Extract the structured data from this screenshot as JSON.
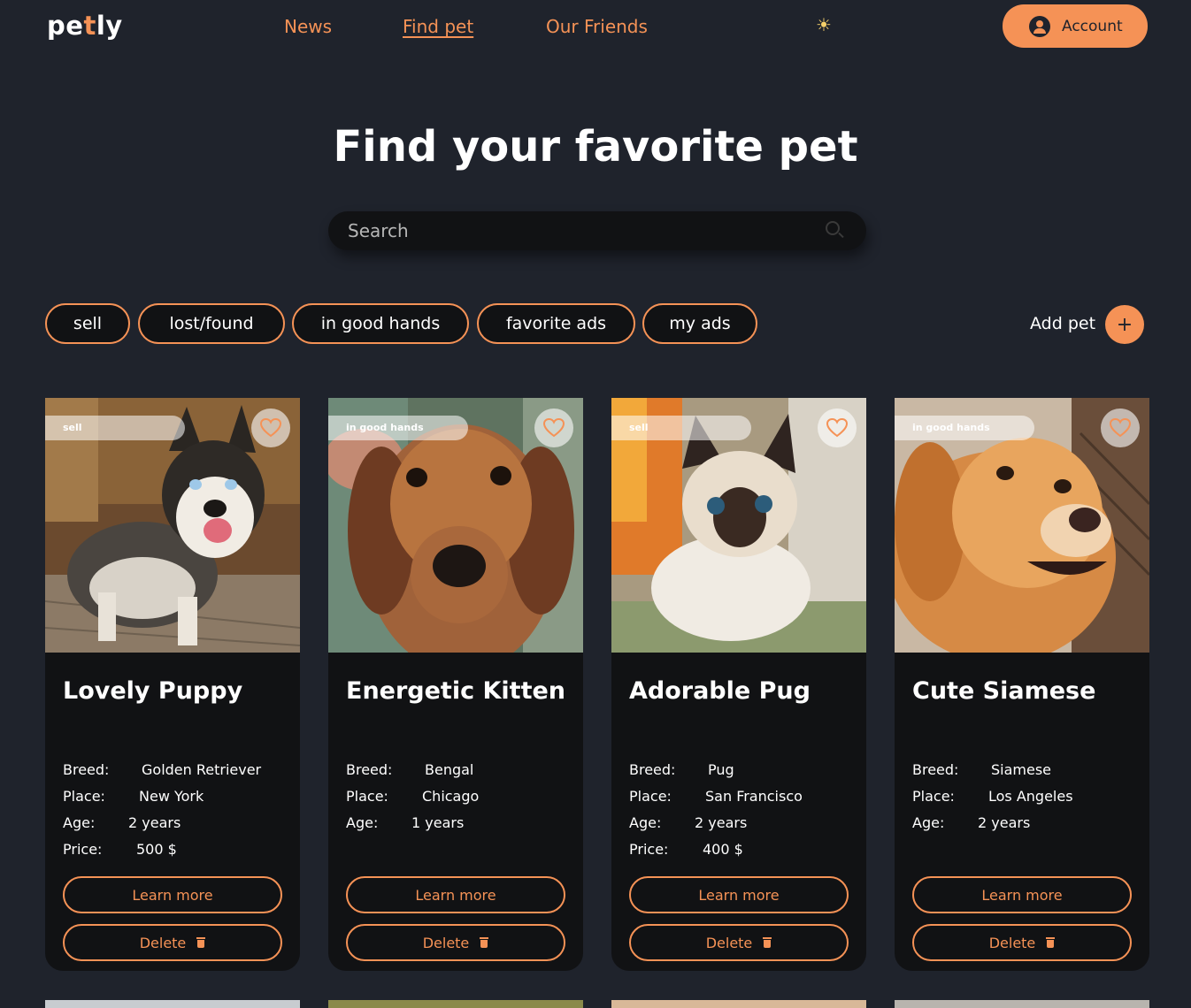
{
  "header": {
    "logo_pre": "pe",
    "logo_t": "t",
    "logo_post": "ly",
    "nav": [
      "News",
      "Find pet",
      "Our Friends"
    ],
    "active_nav": "Find pet",
    "theme_icon": "sun-icon",
    "account_label": "Account"
  },
  "main": {
    "title": "Find your favorite pet",
    "search_placeholder": "Search",
    "filters": [
      "sell",
      "lost/found",
      "in good hands",
      "favorite ads",
      "my ads"
    ],
    "add_pet_label": "Add pet"
  },
  "colors": {
    "accent": "#f59256",
    "background": "#1f232c",
    "card": "#111214"
  },
  "cards": [
    {
      "badge": "sell",
      "title": "Lovely Puppy",
      "fields": [
        {
          "k": "Breed:",
          "v": "Golden Retriever"
        },
        {
          "k": "Place:",
          "v": "New York"
        },
        {
          "k": "Age:",
          "v": "2 years"
        },
        {
          "k": "Price:",
          "v": "500 $"
        }
      ],
      "learn_more": "Learn more",
      "delete": "Delete"
    },
    {
      "badge": "in good hands",
      "title": "Energetic Kitten",
      "fields": [
        {
          "k": "Breed:",
          "v": "Bengal"
        },
        {
          "k": "Place:",
          "v": "Chicago"
        },
        {
          "k": "Age:",
          "v": "1 years"
        }
      ],
      "learn_more": "Learn more",
      "delete": "Delete"
    },
    {
      "badge": "sell",
      "title": "Adorable Pug",
      "fields": [
        {
          "k": "Breed:",
          "v": "Pug"
        },
        {
          "k": "Place:",
          "v": "San Francisco"
        },
        {
          "k": "Age:",
          "v": "2 years"
        },
        {
          "k": "Price:",
          "v": "400 $"
        }
      ],
      "learn_more": "Learn more",
      "delete": "Delete"
    },
    {
      "badge": "in good hands",
      "title": "Cute Siamese",
      "fields": [
        {
          "k": "Breed:",
          "v": "Siamese"
        },
        {
          "k": "Place:",
          "v": "Los Angeles"
        },
        {
          "k": "Age:",
          "v": "2 years"
        }
      ],
      "learn_more": "Learn more",
      "delete": "Delete"
    }
  ]
}
